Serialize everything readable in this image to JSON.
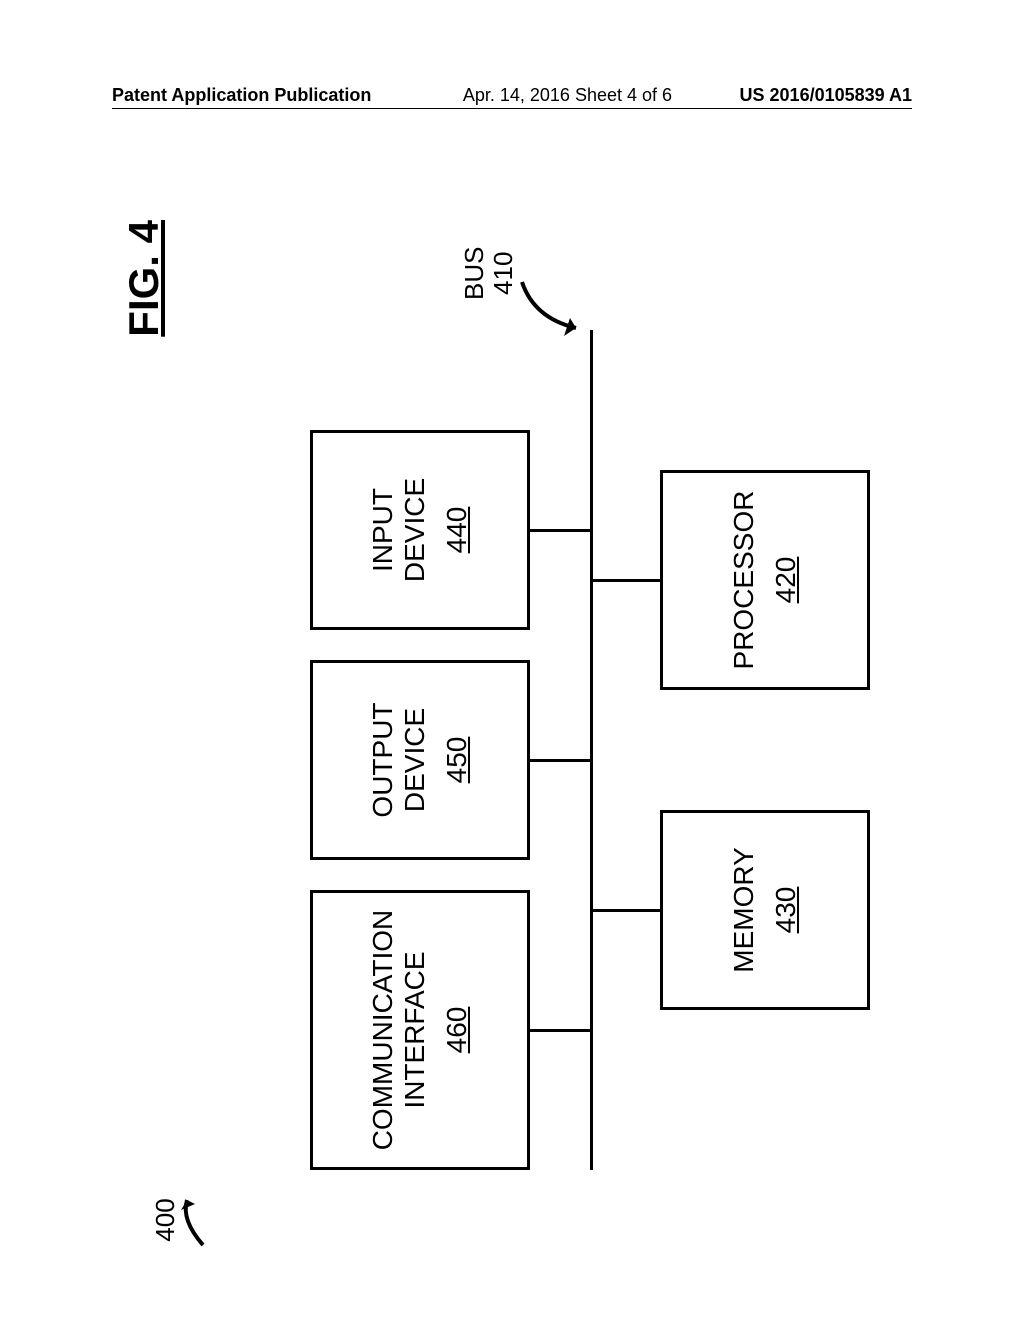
{
  "header": {
    "publication_label": "Patent Application Publication",
    "date_sheet": "Apr. 14, 2016  Sheet 4 of 6",
    "doc_number": "US 2016/0105839 A1"
  },
  "figure": {
    "title": "FIG. 4",
    "ref_label": "400",
    "bus": {
      "label": "BUS",
      "num": "410"
    },
    "boxes": {
      "comm": {
        "line1": "COMMUNICATION",
        "line2": "INTERFACE",
        "num": "460"
      },
      "out": {
        "label": "OUTPUT DEVICE",
        "num": "450"
      },
      "in": {
        "label": "INPUT DEVICE",
        "num": "440"
      },
      "mem": {
        "label": "MEMORY",
        "num": "430"
      },
      "proc": {
        "label": "PROCESSOR",
        "num": "420"
      }
    }
  }
}
